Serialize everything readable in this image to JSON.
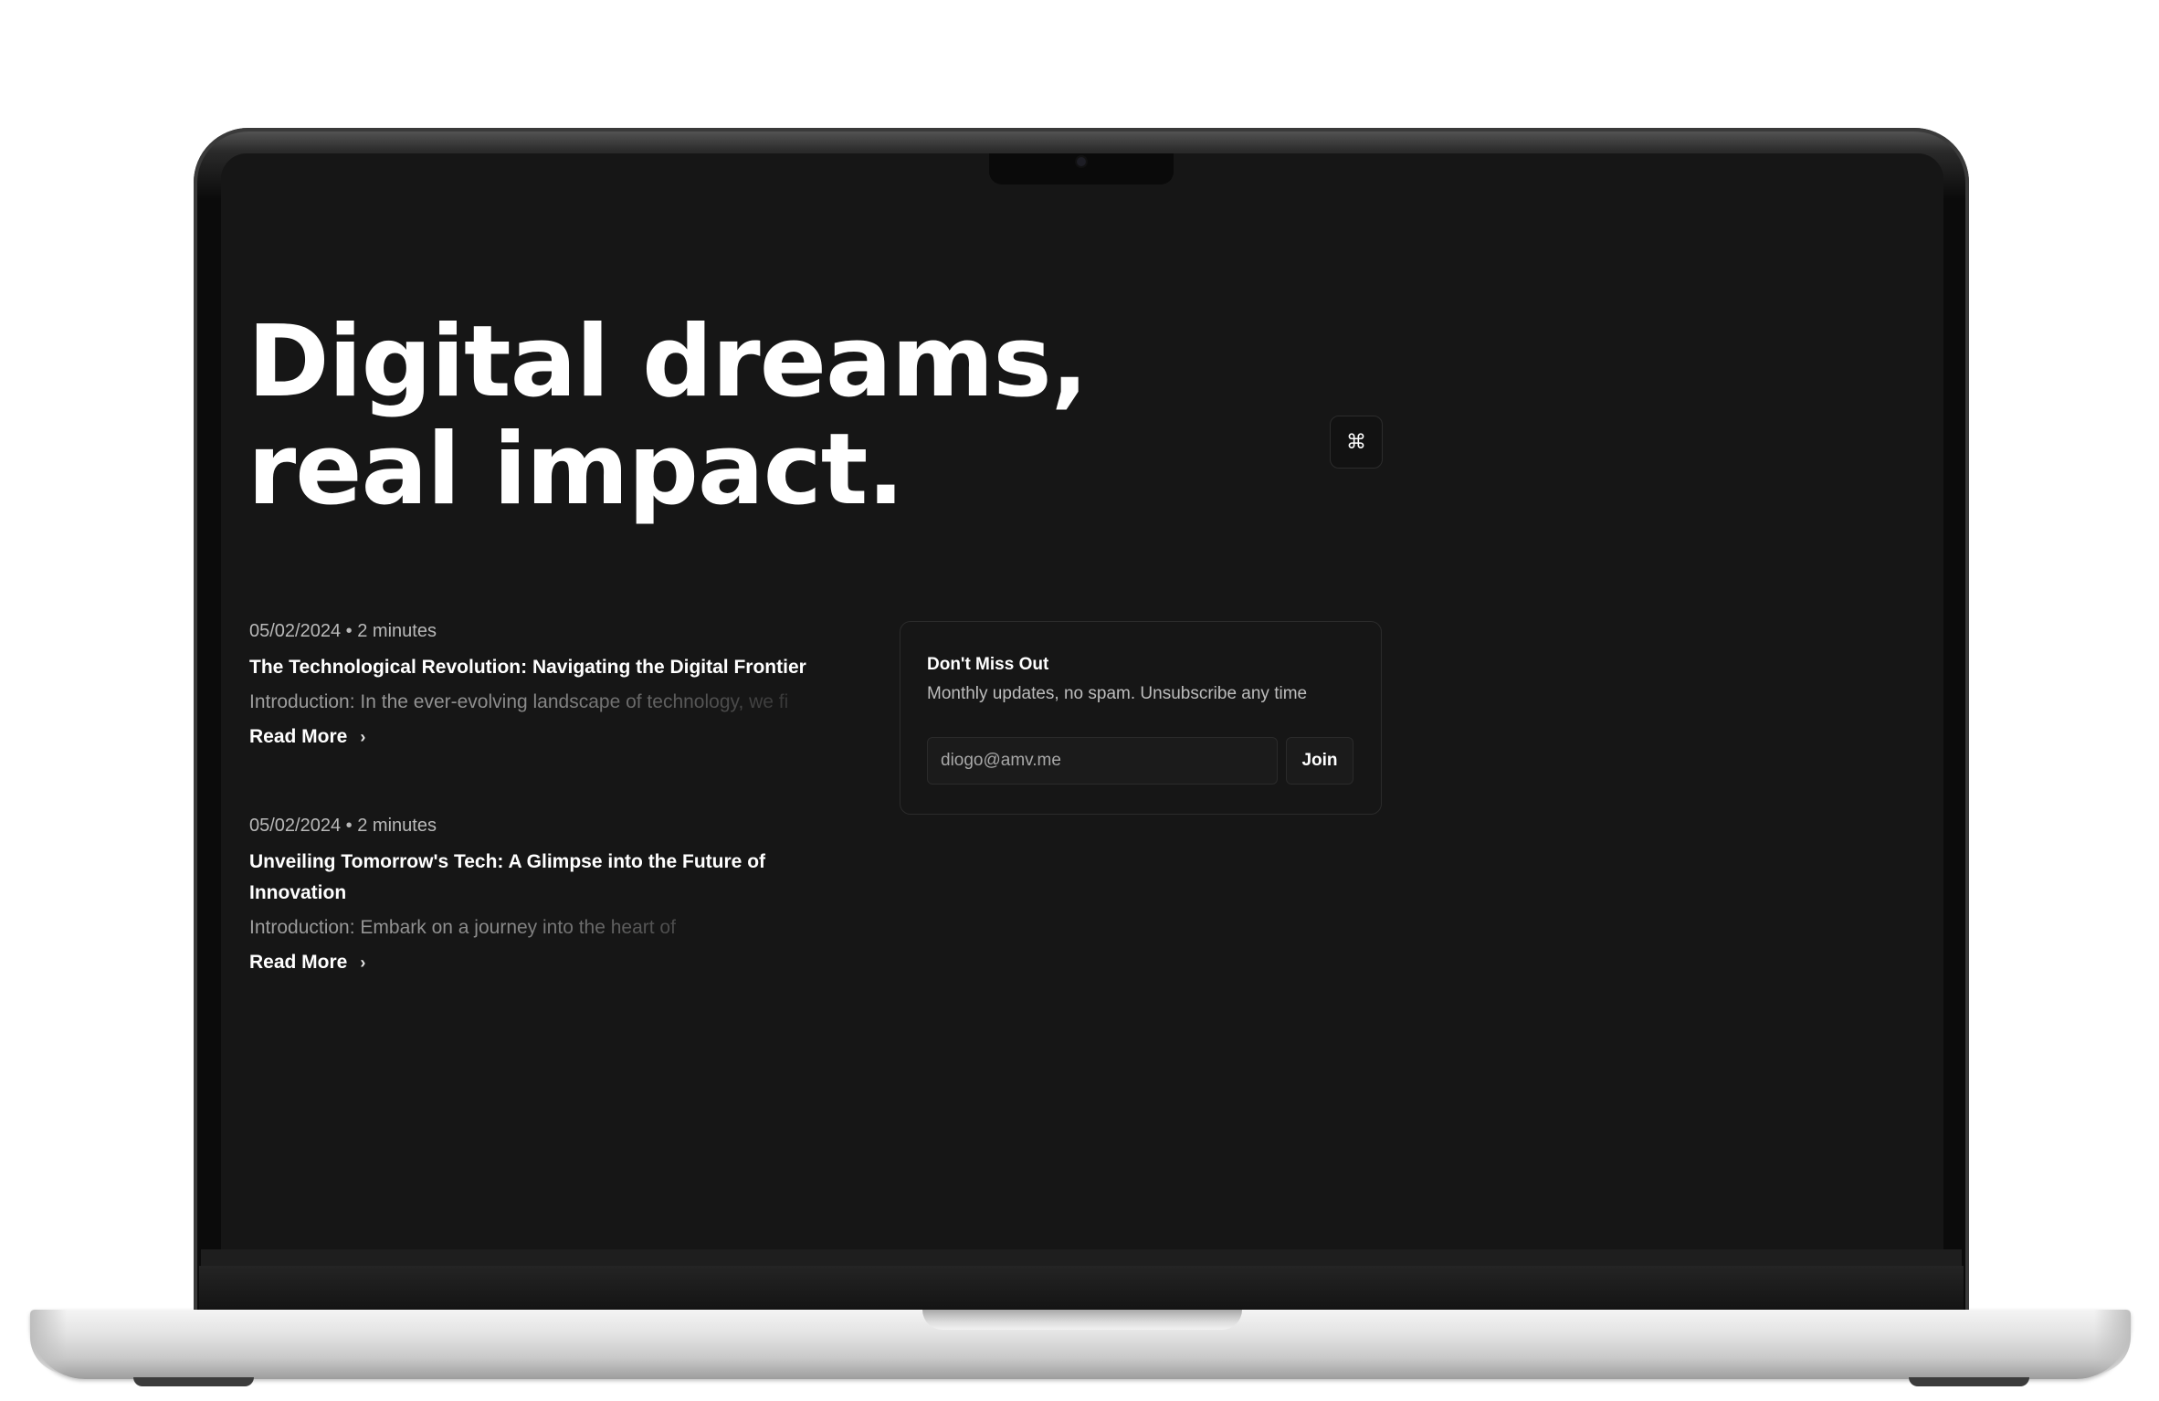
{
  "hero": {
    "line1": "Digital dreams,",
    "line2": "real impact."
  },
  "command_button": {
    "icon": "command-icon",
    "glyph": "⌘"
  },
  "posts": [
    {
      "date": "05/02/2024",
      "separator": "•",
      "read_time": "2 minutes",
      "title": "The Technological Revolution: Navigating the Digital Frontier",
      "excerpt": "Introduction: In the ever-evolving landscape of technology, we fi",
      "read_more": "Read More"
    },
    {
      "date": "05/02/2024",
      "separator": "•",
      "read_time": "2 minutes",
      "title": "Unveiling Tomorrow's Tech: A Glimpse into the Future of Innovation",
      "excerpt": "Introduction: Embark on a journey into the heart of",
      "read_more": "Read More"
    }
  ],
  "newsletter": {
    "title": "Don't Miss Out",
    "subtitle": "Monthly updates, no spam. Unsubscribe any time",
    "email_value": "diogo@amv.me",
    "join_label": "Join"
  },
  "colors": {
    "screen_bg": "#161616",
    "text_primary": "#ffffff",
    "text_muted": "#b9b9b9",
    "border": "#2b2b2b"
  }
}
